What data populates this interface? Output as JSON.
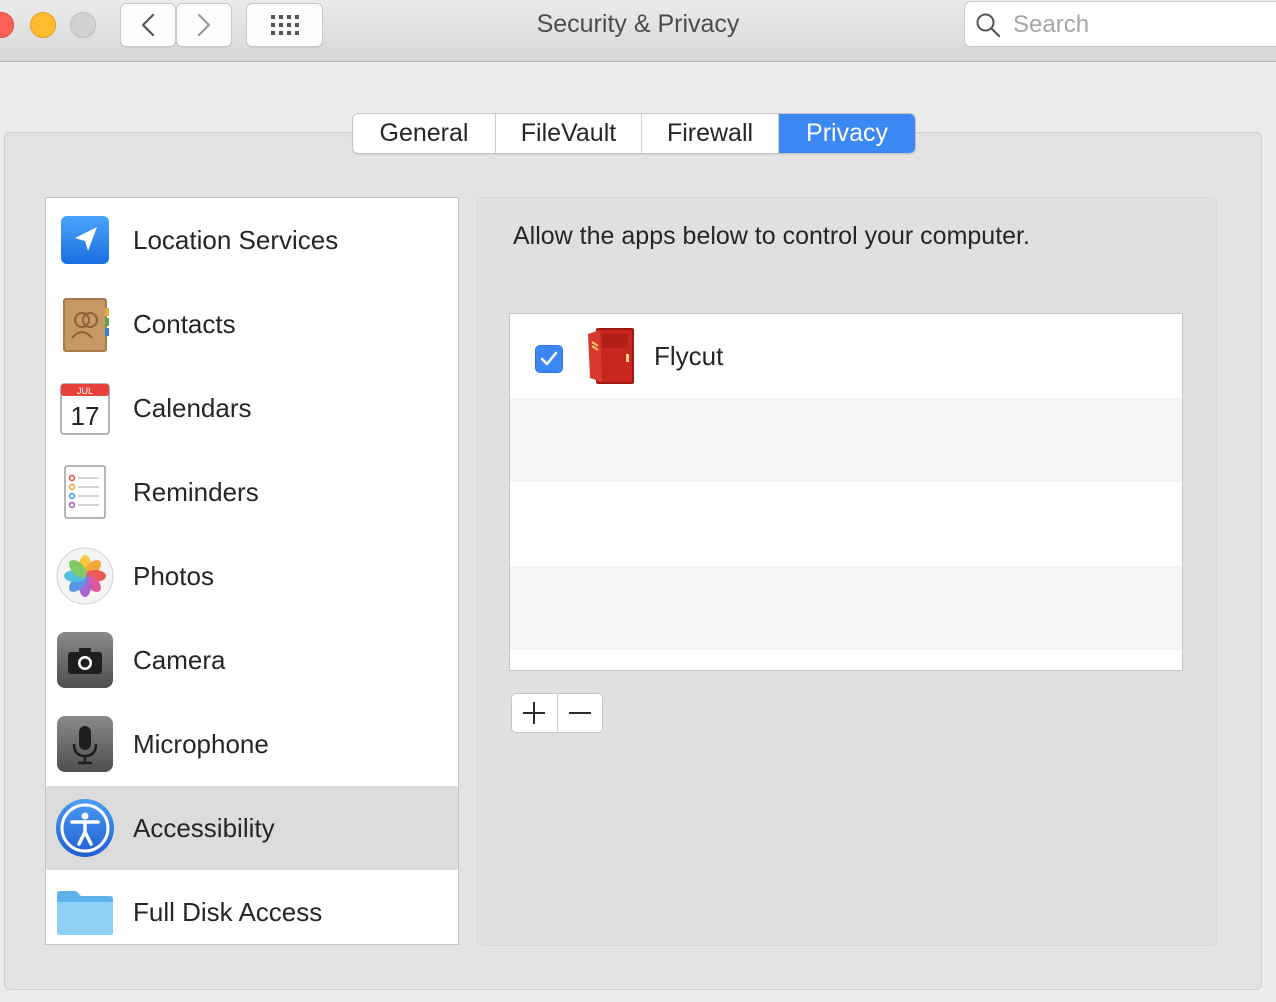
{
  "window": {
    "title": "Security & Privacy"
  },
  "search": {
    "placeholder": "Search"
  },
  "tabs": [
    {
      "label": "General",
      "active": false
    },
    {
      "label": "FileVault",
      "active": false
    },
    {
      "label": "Firewall",
      "active": false
    },
    {
      "label": "Privacy",
      "active": true
    }
  ],
  "sidebar": {
    "items": [
      {
        "label": "Location Services",
        "icon": "location-arrow-icon",
        "selected": false
      },
      {
        "label": "Contacts",
        "icon": "contacts-book-icon",
        "selected": false
      },
      {
        "label": "Calendars",
        "icon": "calendar-icon",
        "selected": false
      },
      {
        "label": "Reminders",
        "icon": "reminders-list-icon",
        "selected": false
      },
      {
        "label": "Photos",
        "icon": "photos-flower-icon",
        "selected": false
      },
      {
        "label": "Camera",
        "icon": "camera-icon",
        "selected": false
      },
      {
        "label": "Microphone",
        "icon": "microphone-icon",
        "selected": false
      },
      {
        "label": "Accessibility",
        "icon": "accessibility-person-icon",
        "selected": true
      },
      {
        "label": "Full Disk Access",
        "icon": "folder-icon",
        "selected": false
      }
    ],
    "calendar_icon": {
      "month": "JUL",
      "day": "17"
    }
  },
  "panel": {
    "description": "Allow the apps below to control your computer.",
    "apps": [
      {
        "name": "Flycut",
        "checked": true,
        "icon": "flycut-locker-icon"
      }
    ],
    "add_label": "+",
    "remove_label": "−"
  },
  "colors": {
    "accent": "#3b88f5",
    "selected_row": "#dcdcdc",
    "close": "#fe5f57",
    "minimize": "#febc2e",
    "zoom_inactive": "#d1d1d1"
  }
}
